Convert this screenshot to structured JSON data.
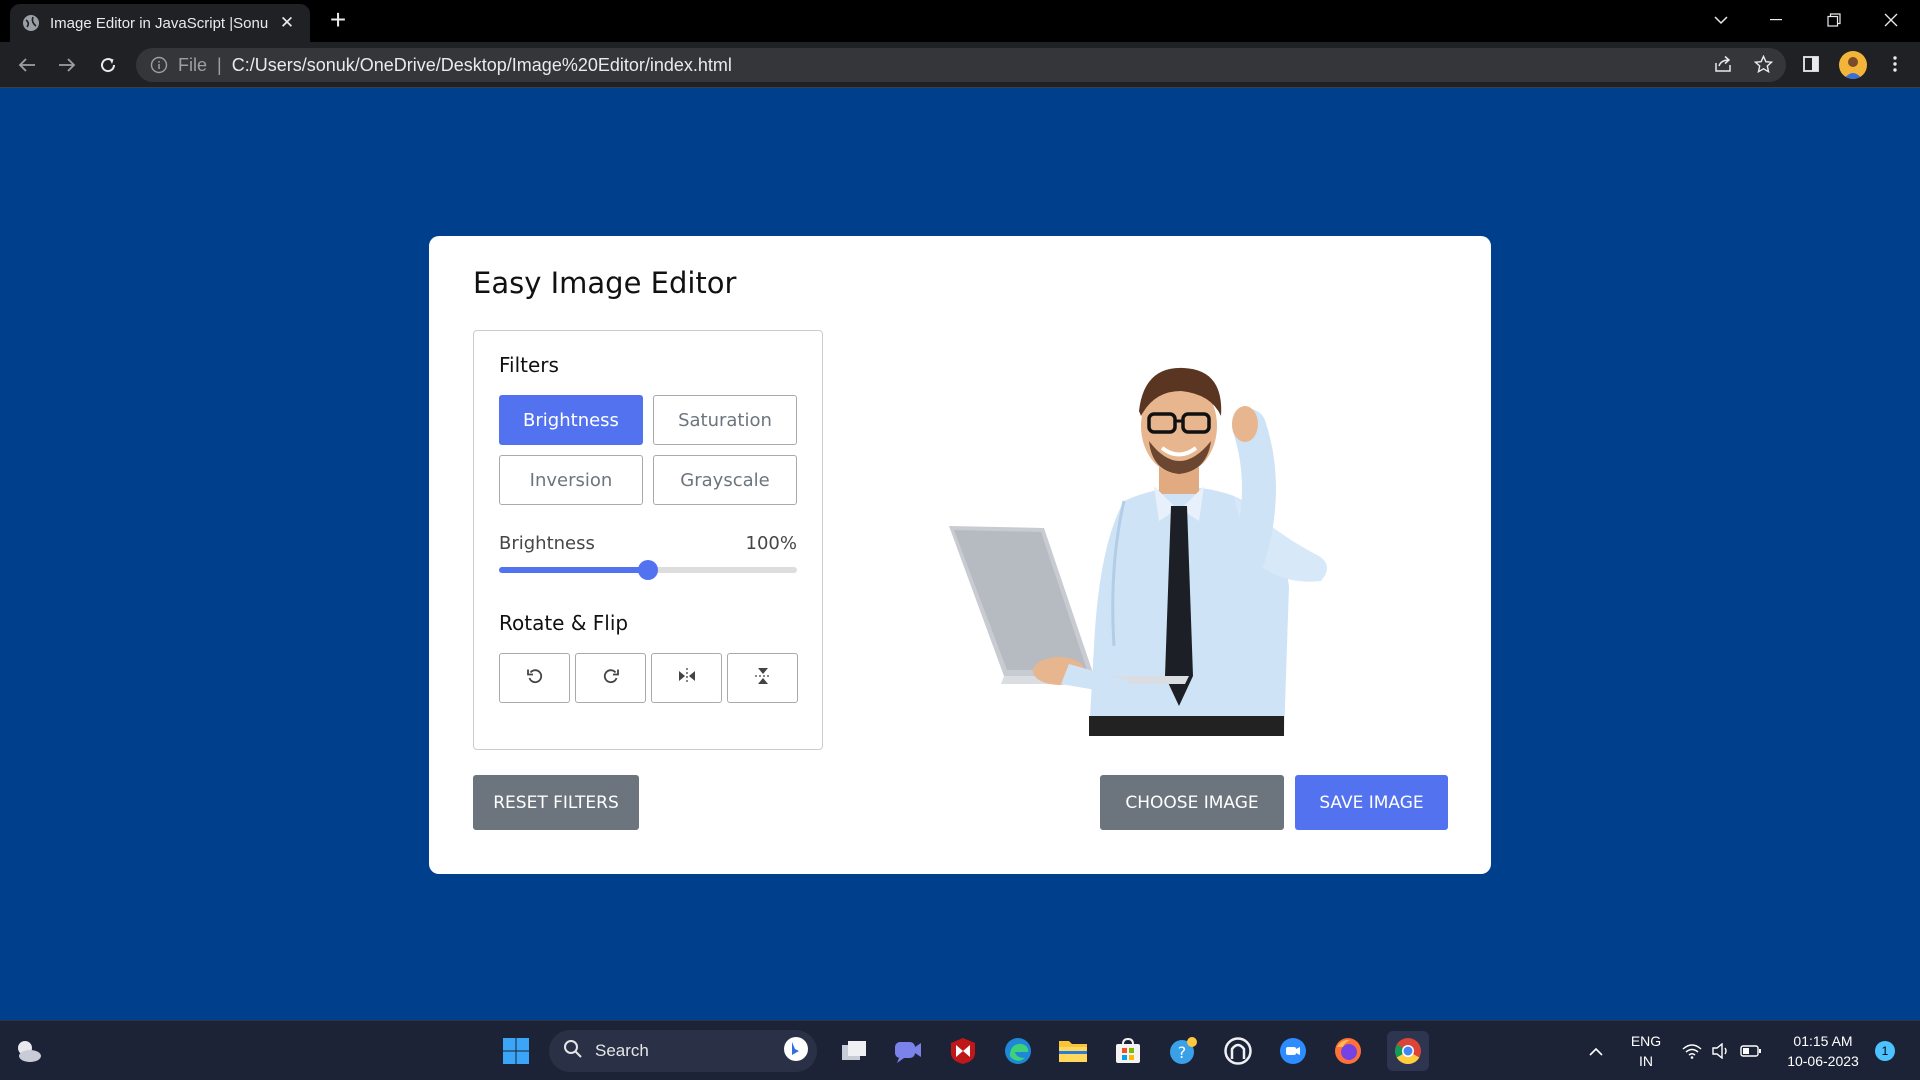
{
  "browser": {
    "tab_title": "Image Editor in JavaScript |Sonu",
    "file_label": "File",
    "url": "C:/Users/sonuk/OneDrive/Desktop/Image%20Editor/index.html"
  },
  "app": {
    "title": "Easy Image Editor",
    "filters_label": "Filters",
    "filters": [
      {
        "label": "Brightness",
        "active": true
      },
      {
        "label": "Saturation",
        "active": false
      },
      {
        "label": "Inversion",
        "active": false
      },
      {
        "label": "Grayscale",
        "active": false
      }
    ],
    "slider": {
      "name": "Brightness",
      "value_text": "100%",
      "fraction": 0.5
    },
    "rotate_label": "Rotate & Flip",
    "rotate_buttons": [
      "rotate-left-icon",
      "rotate-right-icon",
      "flip-horizontal-icon",
      "flip-vertical-icon"
    ],
    "buttons": {
      "reset": "Reset Filters",
      "choose": "Choose Image",
      "save": "Save Image"
    },
    "colors": {
      "accent": "#5372f0",
      "secondary": "#6c757d",
      "background": "#003f8c"
    }
  },
  "taskbar": {
    "search_label": "Search",
    "language": "ENG",
    "region": "IN",
    "time": "01:15 AM",
    "date": "10-06-2023",
    "notifications": "1"
  }
}
